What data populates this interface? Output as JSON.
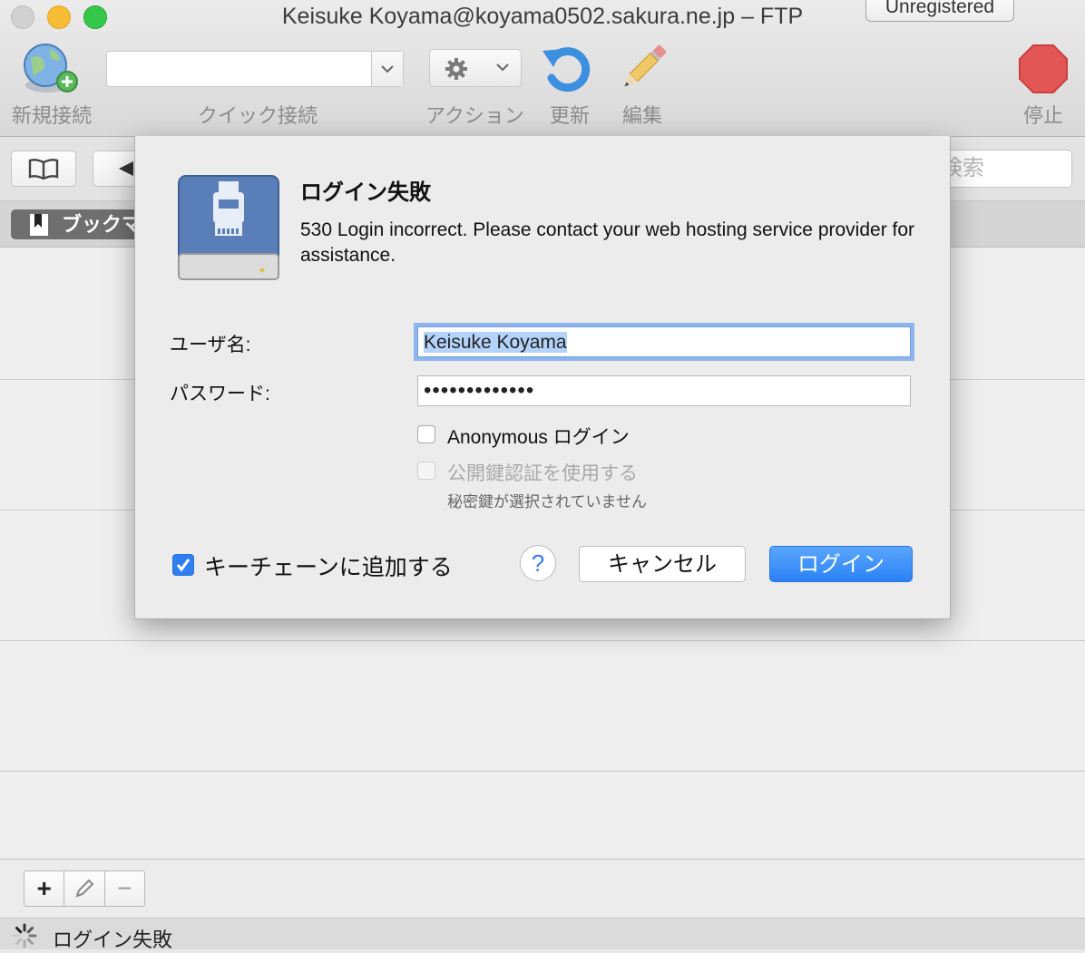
{
  "window": {
    "title": "Keisuke Koyama@koyama0502.sakura.ne.jp – FTP",
    "unregistered_label": "Unregistered"
  },
  "toolbar": {
    "new_connection_label": "新規接続",
    "quick_connect_label": "クイック接続",
    "quick_connect_value": "",
    "action_label": "アクション",
    "refresh_label": "更新",
    "edit_label": "編集",
    "stop_label": "停止"
  },
  "nav": {
    "search_placeholder": "検索",
    "bookmark_tab_label": "ブックマーク"
  },
  "bottom": {
    "add_glyph": "+",
    "remove_glyph": "−"
  },
  "status": {
    "text": "ログイン失敗"
  },
  "dialog": {
    "title": "ログイン失敗",
    "message": "530 Login incorrect. Please contact your web hosting service provider for assistance.",
    "username_label": "ユーザ名:",
    "username_value": "Keisuke Koyama",
    "password_label": "パスワード:",
    "password_dots": "•••••••••••••",
    "anonymous_label": "Anonymous ログイン",
    "anonymous_checked": false,
    "pubkey_label": "公開鍵認証を使用する",
    "pubkey_hint": "秘密鍵が選択されていません",
    "keychain_label": "キーチェーンに追加する",
    "keychain_checked": true,
    "help_glyph": "?",
    "cancel_label": "キャンセル",
    "login_label": "ログイン"
  },
  "colors": {
    "accent": "#2f7ff0",
    "focus_ring": "#8fb6ec",
    "selection": "#b3d3fb",
    "stop_red": "#e25656"
  }
}
